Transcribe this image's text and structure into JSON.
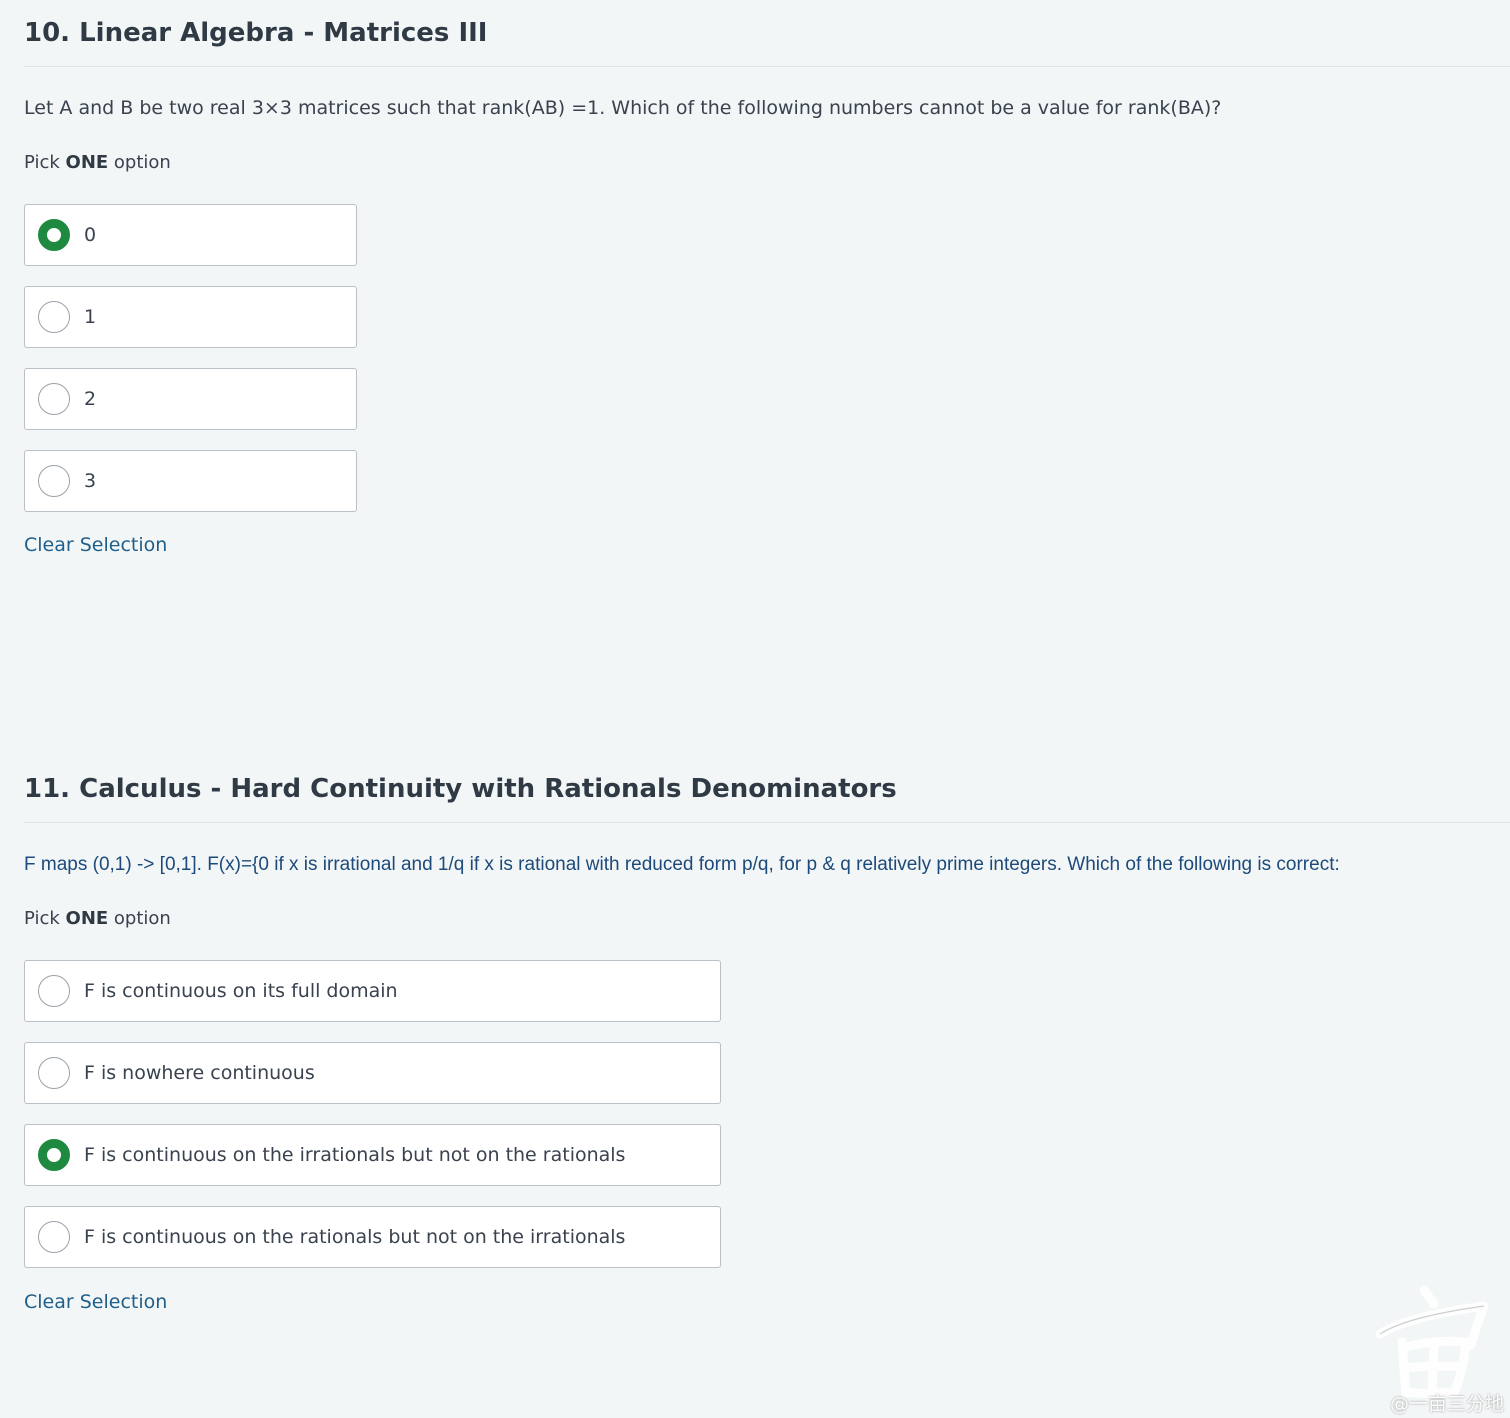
{
  "questions": [
    {
      "title": "10. Linear Algebra - Matrices III",
      "prompt": "Let A and B be two real 3×3 matrices such that rank(AB) =1. Which of the following numbers cannot be a value for rank(BA)?",
      "pick_prefix": "Pick ",
      "pick_emphasis": "ONE",
      "pick_suffix": " option",
      "options": [
        {
          "label": "0",
          "selected": true
        },
        {
          "label": "1",
          "selected": false
        },
        {
          "label": "2",
          "selected": false
        },
        {
          "label": "3",
          "selected": false
        }
      ],
      "clear_label": "Clear Selection"
    },
    {
      "title": "11. Calculus - Hard Continuity with Rationals Denominators",
      "prompt": "F maps (0,1) -> [0,1].  F(x)={0 if x is irrational and 1/q if x is rational with reduced form p/q, for p & q relatively prime integers. Which of the following is correct:",
      "pick_prefix": "Pick ",
      "pick_emphasis": "ONE",
      "pick_suffix": " option",
      "options": [
        {
          "label": "F is continuous on its full domain",
          "selected": false
        },
        {
          "label": "F is nowhere continuous",
          "selected": false
        },
        {
          "label": "F is continuous on the irrationals but not on the rationals",
          "selected": true
        },
        {
          "label": "F is continuous on the rationals but not on the irrationals",
          "selected": false
        }
      ],
      "clear_label": "Clear Selection"
    }
  ],
  "colors": {
    "background": "#f3f6f7",
    "selected_radio": "#1e8a3f",
    "link": "#1f5f8b",
    "prompt_blue": "#1d4a7a"
  },
  "watermark": {
    "text": "@一亩三分地",
    "icon": "mu-logo-icon"
  }
}
